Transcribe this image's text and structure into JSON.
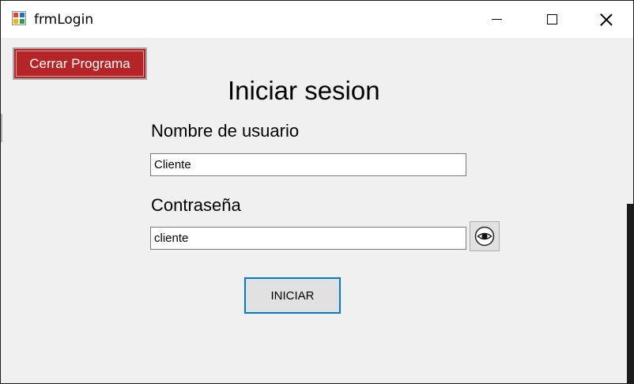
{
  "window": {
    "title": "frmLogin",
    "controls": {
      "minimize": "minimize-icon",
      "maximize": "maximize-icon",
      "close": "close-icon"
    }
  },
  "exit_button": {
    "label": "Cerrar Programa",
    "color": "#b52528"
  },
  "form": {
    "heading": "Iniciar sesion",
    "username_label": "Nombre de usuario",
    "username_value": "Cliente",
    "password_label": "Contraseña",
    "password_value": "cliente",
    "show_password_icon": "eye-icon",
    "submit_label": "INICIAR"
  },
  "colors": {
    "focus_border": "#0078d7",
    "background": "#f0f0f0"
  }
}
